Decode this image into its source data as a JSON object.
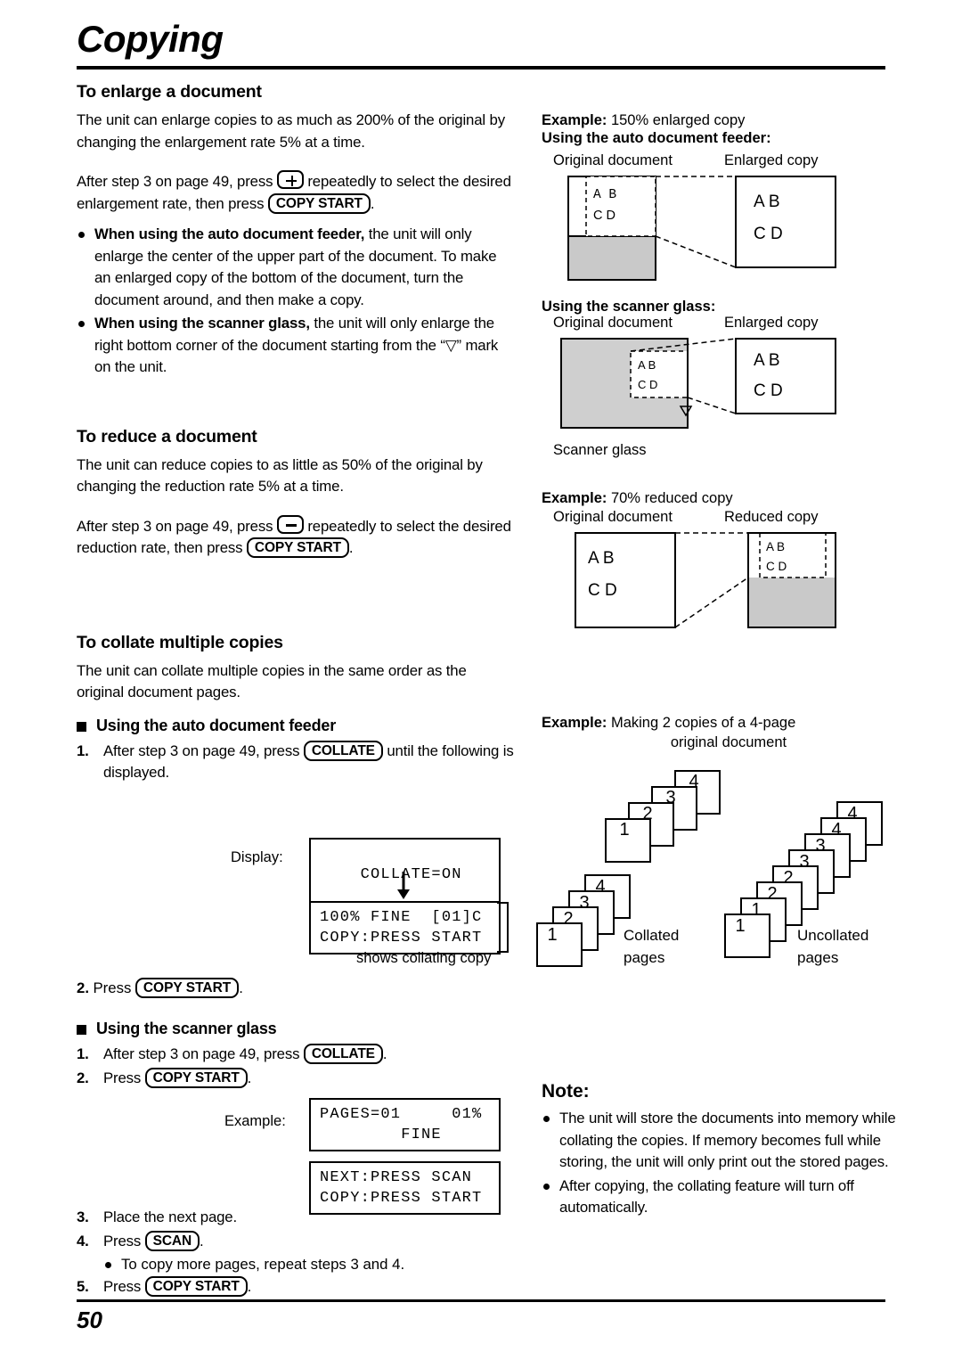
{
  "page": {
    "title": "Copying",
    "number": "50"
  },
  "sections": {
    "enlarge": {
      "heading": "To enlarge a document",
      "para1": "The unit can enlarge copies to as much as 200% of the original by changing the enlargement rate 5% at a time.",
      "para2_a": "After step 3 on page 49, press",
      "para2_key": "plus-key",
      "para2_b": "repeatedly to select the desired enlargement rate, then press",
      "para2_key2": "COPY START",
      "para2_c": ".",
      "bullet1_bold": "When using the auto document feeder,",
      "bullet1_text": " the unit will only enlarge the center of the upper part of the document. To make an enlarged copy of the bottom of the document, turn the document around, and then make a copy.",
      "bullet2_bold": "When using the scanner glass,",
      "bullet2_text": " the unit will only enlarge the right bottom corner of the document starting from the “▽” mark on the unit."
    },
    "reduce": {
      "heading": "To reduce a document",
      "para1": "The unit can reduce copies to as little as 50% of the original by changing the reduction rate 5% at a time.",
      "para2_a": "After step 3 on page 49, press",
      "para2_b": "repeatedly to select the desired reduction rate, then press",
      "para2_key2": "COPY START",
      "para2_c": "."
    },
    "collate": {
      "heading": "To collate multiple copies",
      "para1": "The unit can collate multiple copies in the same order as the original document pages.",
      "adf_heading": "Using the auto document feeder",
      "adf_step1_num": "1.",
      "adf_step1_a": "After step 3 on page 49, press",
      "adf_step1_key": "COLLATE",
      "adf_step1_b": "until the following is displayed.",
      "display_label": "Display:",
      "lcd1": "COLLATE=ON",
      "lcd2_line1": "100% FINE  [01]C",
      "lcd2_line2": "COPY:PRESS START",
      "shows_note": "shows collating copy",
      "adf_step2_num": "2.",
      "adf_step2_a": "Press",
      "adf_step2_key": "COPY START",
      "adf_step2_b": ".",
      "glass_heading": "Using the scanner glass",
      "glass_step1_num": "1.",
      "glass_step1_a": "After step 3 on page 49, press",
      "glass_step1_key": "COLLATE",
      "glass_step1_b": ".",
      "glass_step2_num": "2.",
      "glass_step2_a": "Press",
      "glass_step2_key": "COPY START",
      "glass_step2_b": ".",
      "example_label": "Example:",
      "lcd3_line1": "PAGES=01     01%",
      "lcd3_line2": "        FINE",
      "lcd4_line1": "NEXT:PRESS SCAN",
      "lcd4_line2": "COPY:PRESS START",
      "glass_step3_num": "3.",
      "glass_step3_text": "Place the next page.",
      "glass_step4_num": "4.",
      "glass_step4_a": "Press",
      "glass_step4_key": "SCAN",
      "glass_step4_b": ".",
      "glass_sub": "To copy more pages, repeat steps 3 and 4.",
      "glass_step5_num": "5.",
      "glass_step5_a": "Press",
      "glass_step5_key": "COPY START",
      "glass_step5_b": "."
    }
  },
  "figures": {
    "enlarge150": {
      "caption_bold": "Example:",
      "caption_rest": " 150% enlarged copy",
      "sub1": "Using the auto document feeder:",
      "orig_label": "Original document",
      "result_label": "Enlarged copy",
      "letters": [
        "A",
        "B",
        "C",
        "D"
      ],
      "sub2": "Using the scanner glass:",
      "orig_label2": "Original document",
      "result_label2": "Enlarged copy",
      "scanner_glass_label": "Scanner glass"
    },
    "reduce70": {
      "caption_bold": "Example:",
      "caption_rest": " 70% reduced copy",
      "orig_label": "Original document",
      "result_label": "Reduced copy"
    },
    "collate": {
      "caption_bold": "Example:",
      "caption_rest": " Making 2 copies of a 4-page",
      "caption_line2": "original document",
      "pages": [
        "4",
        "3",
        "2",
        "1"
      ],
      "collated_label_line1": "Collated",
      "collated_label_line2": "pages",
      "uncollated_label_line1": "Uncollated",
      "uncollated_label_line2": "pages",
      "collated_stack1": [
        "4",
        "3",
        "2",
        "1"
      ],
      "collated_stack2": [
        "4",
        "3",
        "2",
        "1"
      ],
      "uncollated_stack1": [
        "4",
        "4",
        "3",
        "2"
      ],
      "uncollated_stack2": [
        "3",
        "2",
        "1"
      ]
    }
  },
  "note": {
    "heading": "Note:",
    "bullet1": "The unit will store the documents into memory while collating the copies. If memory becomes full while storing, the unit will only print out the stored pages.",
    "bullet2": "After copying, the collating feature will turn off automatically."
  }
}
